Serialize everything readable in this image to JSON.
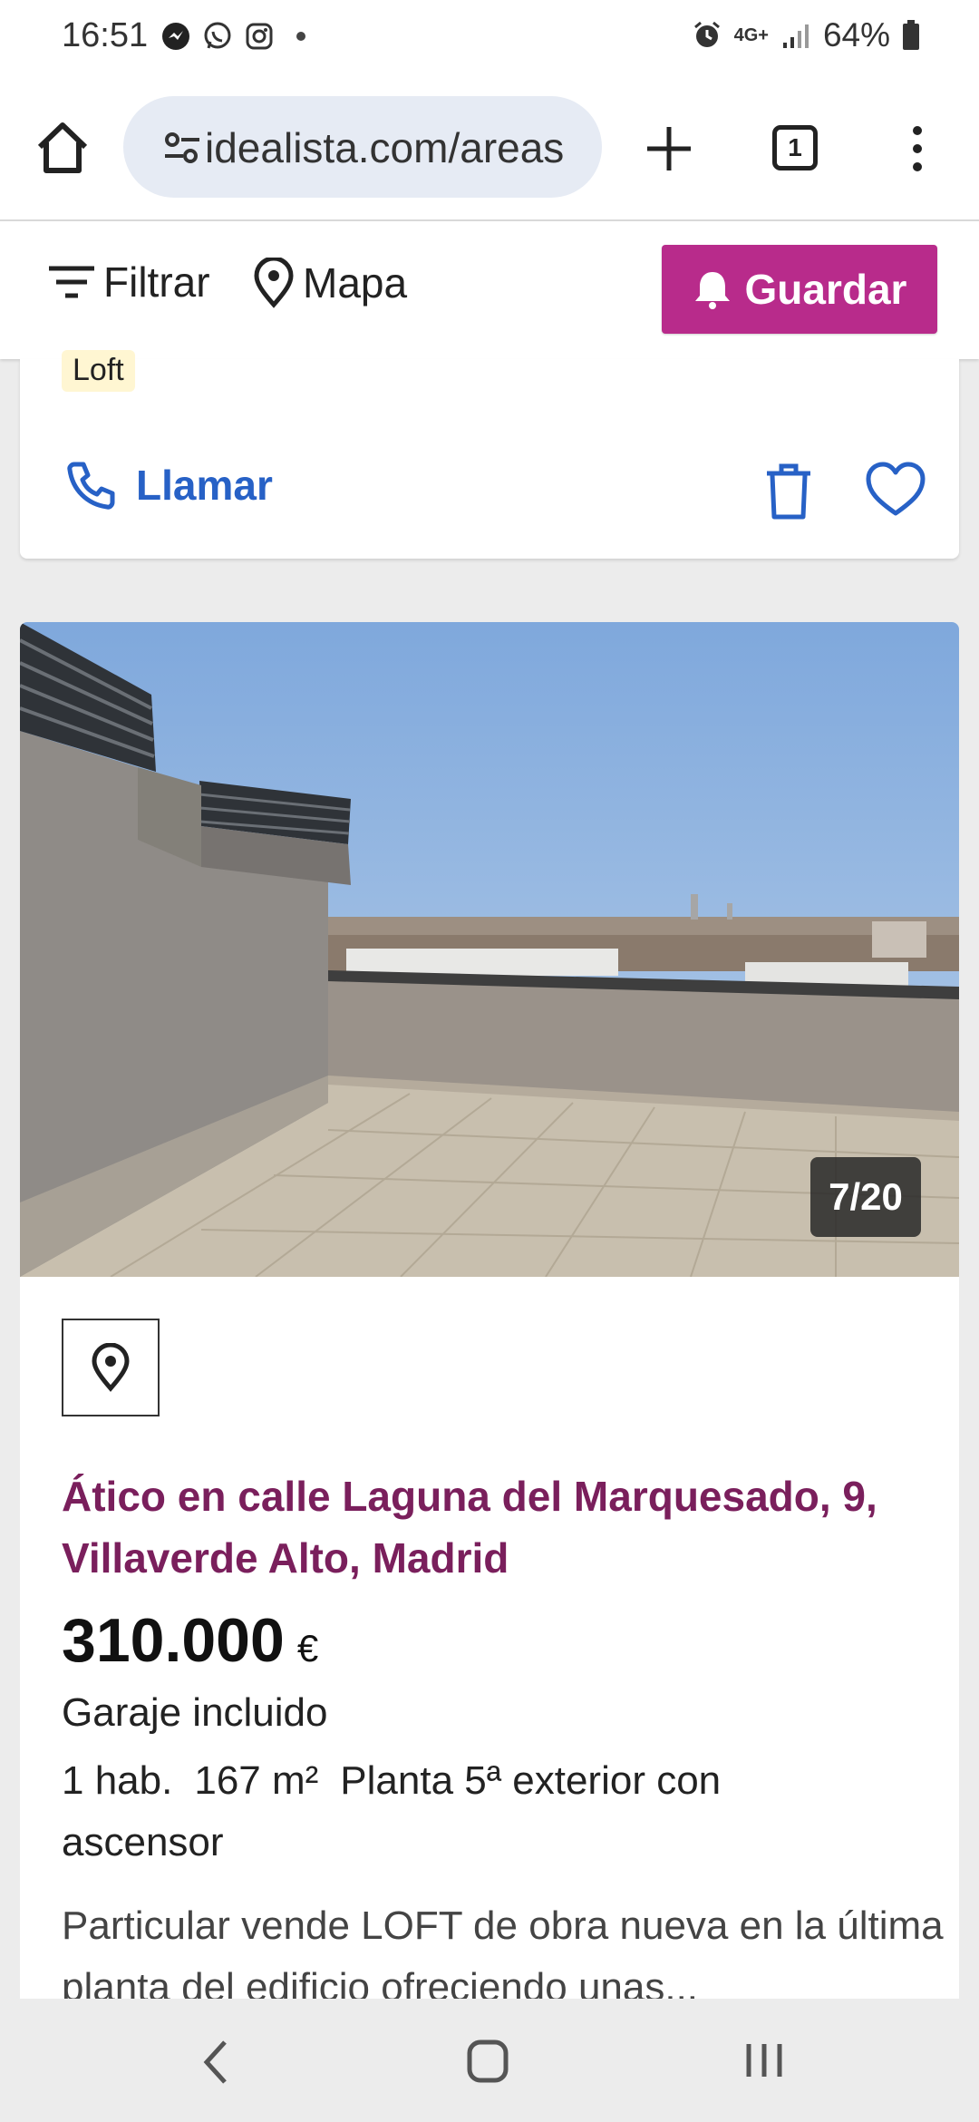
{
  "status_bar": {
    "time": "16:51",
    "notification_icons": [
      "messenger-icon",
      "whatsapp-icon",
      "instagram-icon",
      "dot-icon"
    ],
    "network": "4G+",
    "battery": "64%"
  },
  "browser": {
    "url": "idealista.com/areas",
    "tab_count": "1"
  },
  "toolbar": {
    "filter_label": "Filtrar",
    "map_label": "Mapa",
    "save_label": "Guardar"
  },
  "previous_listing": {
    "tag": "Loft",
    "call_label": "Llamar"
  },
  "listing": {
    "photo_counter": "7/20",
    "title": "Ático en calle Laguna del Marquesado, 9, Villaverde Alto, Madrid",
    "price": "310.000",
    "currency": "€",
    "parking": "Garaje incluido",
    "rooms": "1 hab.",
    "area": "167 m²",
    "floor": "Planta 5ª exterior con ascensor",
    "description": "Particular vende LOFT de obra nueva en la última planta del edificio ofreciendo unas..."
  },
  "colors": {
    "brand": "#b82b8b",
    "title": "#7a1f5c",
    "link": "#2761c6"
  }
}
